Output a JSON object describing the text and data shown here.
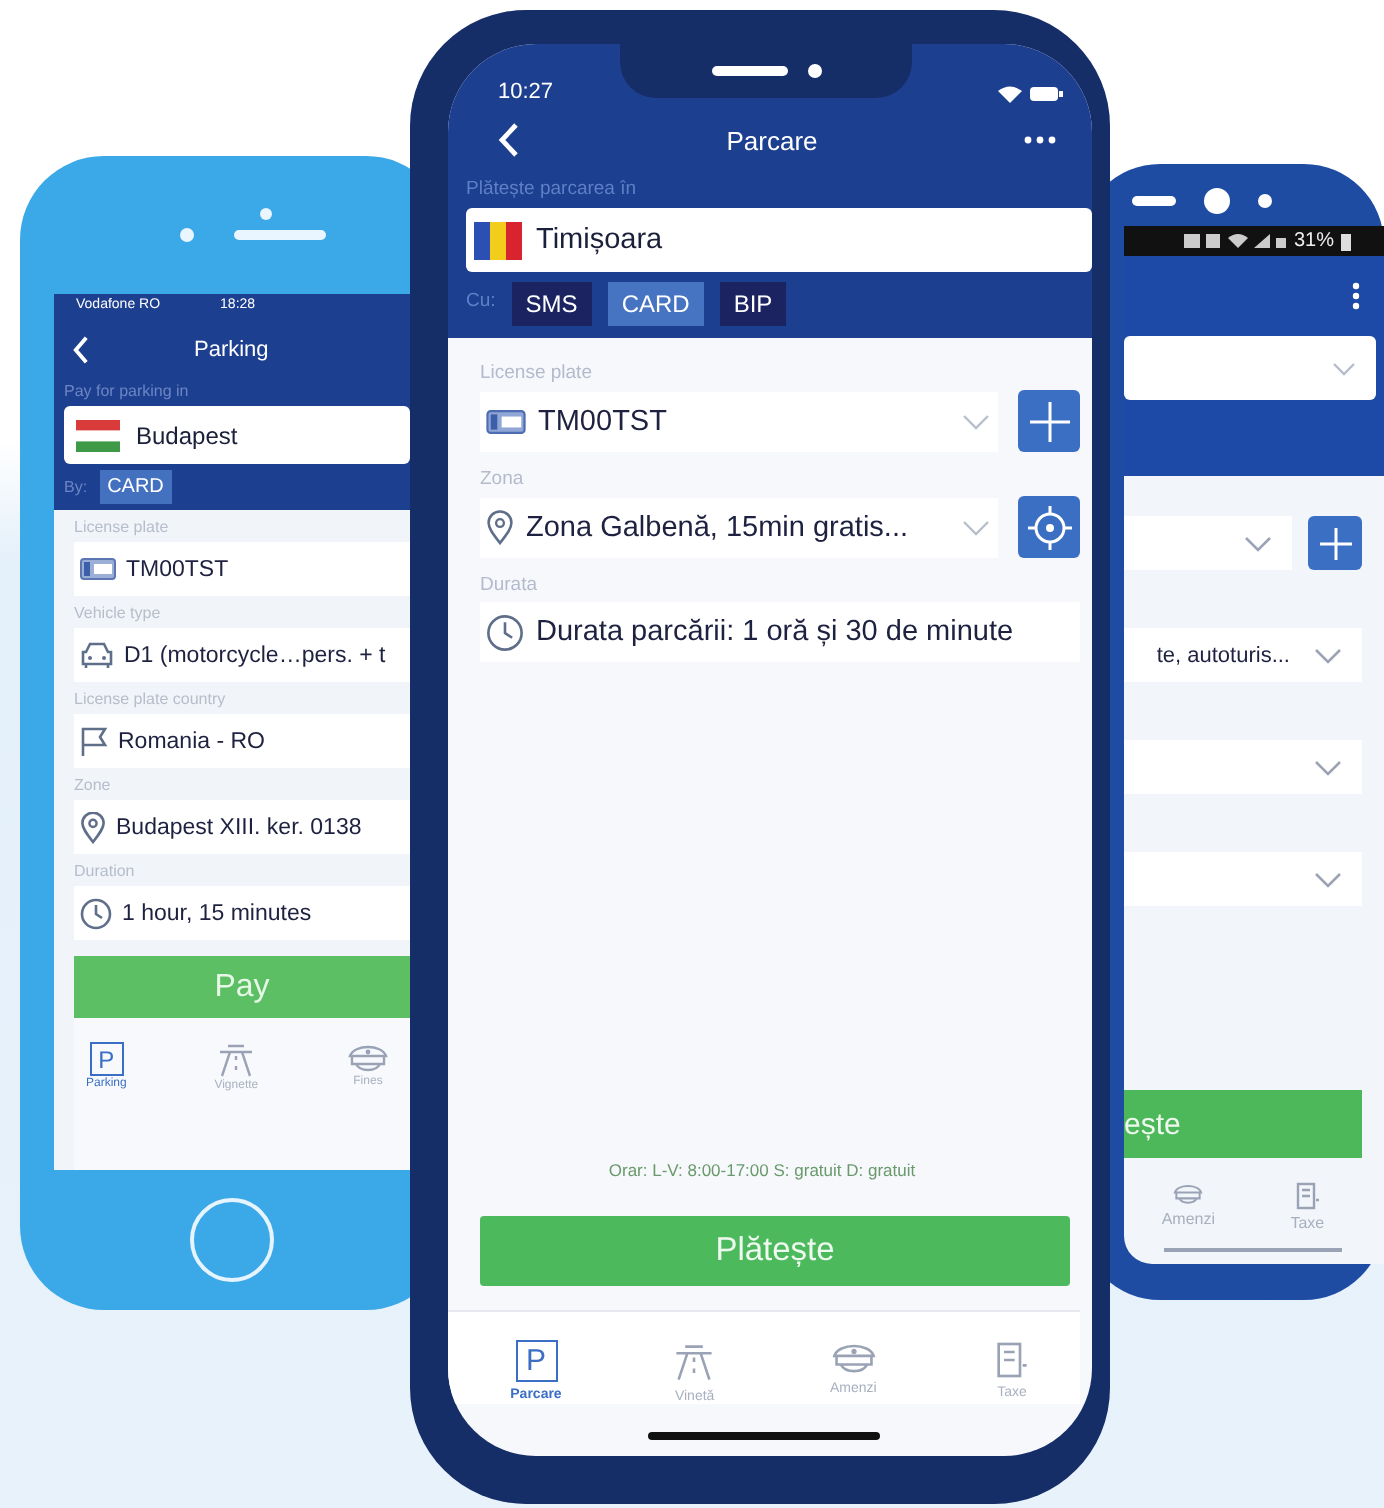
{
  "left_phone": {
    "status_bar": {
      "carrier": "Vodafone RO",
      "time": "18:28"
    },
    "title": "Parking",
    "city_label": "Pay for parking in",
    "city": "Budapest",
    "method_label": "By:",
    "methods": [
      {
        "label": "CARD",
        "selected": true
      }
    ],
    "fields": [
      {
        "label": "License plate",
        "value": "TM00TST",
        "kind": "plate"
      },
      {
        "label": "Vehicle type",
        "value": "D1 (motorcycle…pers. + t",
        "kind": "car"
      },
      {
        "label": "License plate country",
        "value": "Romania - RO",
        "kind": "flag"
      },
      {
        "label": "Zone",
        "value": "Budapest XIII. ker. 0138",
        "kind": "pin"
      },
      {
        "label": "Duration",
        "value": "1 hour, 15 minutes",
        "kind": "clock"
      }
    ],
    "pay_button": "Pay",
    "tabs": [
      {
        "label": "Parking",
        "kind": "parking",
        "glyph": "P",
        "selected": true
      },
      {
        "label": "Vignette",
        "kind": "road",
        "selected": false
      },
      {
        "label": "Fines",
        "kind": "cap",
        "selected": false
      }
    ]
  },
  "center_phone": {
    "status_bar": {
      "time": "10:27"
    },
    "title": "Parcare",
    "city_label": "Plătește parcarea în",
    "city": "Timișoara",
    "method_label": "Cu:",
    "methods": [
      {
        "label": "SMS",
        "selected": false
      },
      {
        "label": "CARD",
        "selected": true
      },
      {
        "label": "BIP",
        "selected": false
      }
    ],
    "fields": [
      {
        "label": "License plate",
        "value": "TM00TST",
        "kind": "plate",
        "dropdown": true,
        "button": {
          "kind": "plus"
        }
      },
      {
        "label": "Zona",
        "value": "Zona Galbenă, 15min gratis...",
        "kind": "pin",
        "dropdown": true,
        "button": {
          "kind": "locate"
        }
      },
      {
        "label": "Durata",
        "value": "Durata parcării: 1 oră și 30 de minute",
        "kind": "clock",
        "dropdown": false
      }
    ],
    "hours_note": "Orar: L-V: 8:00-17:00 S: gratuit D: gratuit",
    "pay_button": "Plătește",
    "tabs": [
      {
        "label": "Parcare",
        "kind": "parking",
        "glyph": "P",
        "selected": true
      },
      {
        "label": "Vinetă",
        "kind": "road",
        "selected": false
      },
      {
        "label": "Amenzi",
        "kind": "cap",
        "selected": false
      },
      {
        "label": "Taxe",
        "kind": "form",
        "selected": false
      }
    ]
  },
  "right_phone": {
    "status_bar": {
      "battery": "31%"
    },
    "header_fields": [
      {
        "dropdown": true
      }
    ],
    "fields": [
      {
        "dropdown": true,
        "button": {
          "kind": "plus"
        }
      },
      {
        "value": "te, autoturis...",
        "dropdown": true
      },
      {
        "dropdown": true
      },
      {
        "dropdown": true
      }
    ],
    "pay_button": "ește",
    "tabs": [
      {
        "label": "Amenzi",
        "kind": "cap",
        "selected": false
      },
      {
        "label": "Taxe",
        "kind": "form",
        "selected": false
      }
    ]
  }
}
